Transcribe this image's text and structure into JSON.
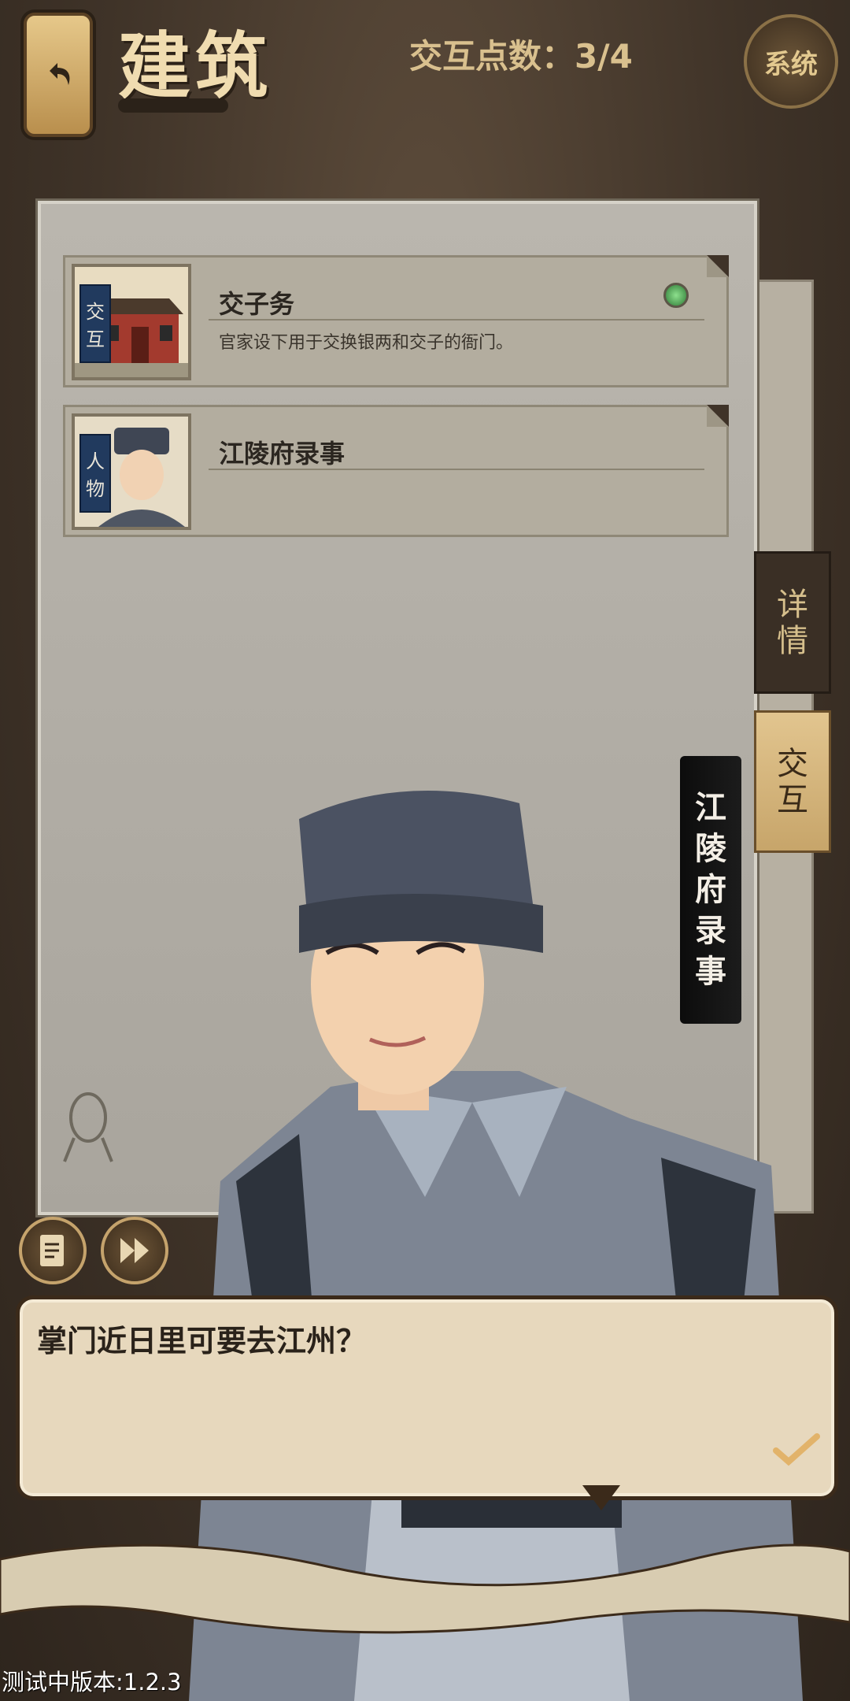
{
  "header": {
    "title": "建筑",
    "points_label": "交互点数：3/4",
    "system_label": "系统"
  },
  "list": [
    {
      "tag": [
        "交",
        "互"
      ],
      "title": "交子务",
      "desc": "官家设下用于交换银两和交子的衙门。",
      "has_gem": true
    },
    {
      "tag": [
        "人",
        "物"
      ],
      "title": "江陵府录事",
      "desc": "",
      "has_gem": false
    }
  ],
  "tabs": {
    "detail": [
      "详",
      "情"
    ],
    "interact": [
      "交",
      "互"
    ]
  },
  "speaker": [
    "江",
    "陵",
    "府",
    "录",
    "事"
  ],
  "dialog": {
    "text": "掌门近日里可要去江州？"
  },
  "footer": {
    "version": "测试中版本:1.2.3"
  },
  "colors": {
    "accent": "#d9c08e",
    "panel": "#b3ad9f",
    "gem": "#2e7a36"
  }
}
